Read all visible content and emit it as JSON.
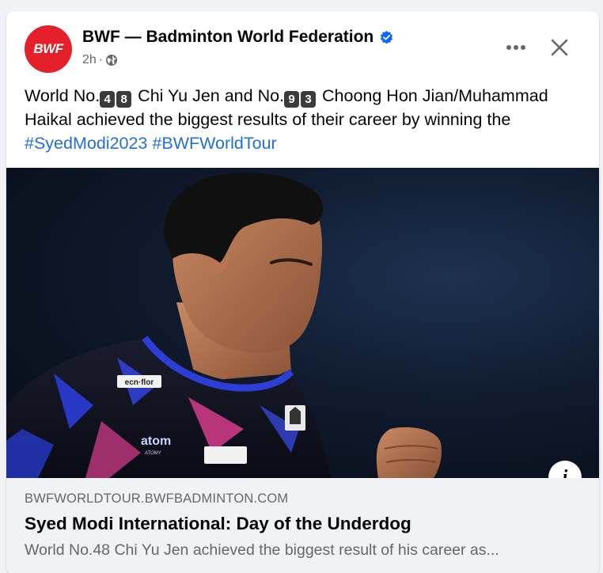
{
  "post": {
    "page_name": "BWF — Badminton World Federation",
    "avatar_text": "BWF",
    "time": "2h",
    "separator": "·",
    "text": {
      "p1": "World No.",
      "rank1_d1": "4",
      "rank1_d2": "8",
      "p2": " Chi Yu Jen and No.",
      "rank2_d1": "9",
      "rank2_d2": "3",
      "p3": " Choong Hon Jian/Muhammad Haikal achieved the biggest results of their career by winning the ",
      "hashtag1": "#SyedModi2023",
      "space": " ",
      "hashtag2": "#BWFWorldTour"
    }
  },
  "photo": {
    "shirt_text_1": "ecn·flor",
    "shirt_text_2": "atom",
    "shirt_text_3": "ATOMY"
  },
  "link_preview": {
    "domain": "BWFWORLDTOUR.BWFBADMINTON.COM",
    "title": "Syed Modi International: Day of the Underdog",
    "description": "World No.48 Chi Yu Jen achieved the biggest result of his career as..."
  },
  "info_icon_label": "i",
  "colors": {
    "brand": "#e4202a",
    "link": "#216fdb",
    "verified": "#0866ff",
    "secondary_text": "#65676b"
  },
  "icons": [
    "verified-badge-icon",
    "globe-icon",
    "more-dots-icon",
    "close-icon",
    "info-icon"
  ]
}
